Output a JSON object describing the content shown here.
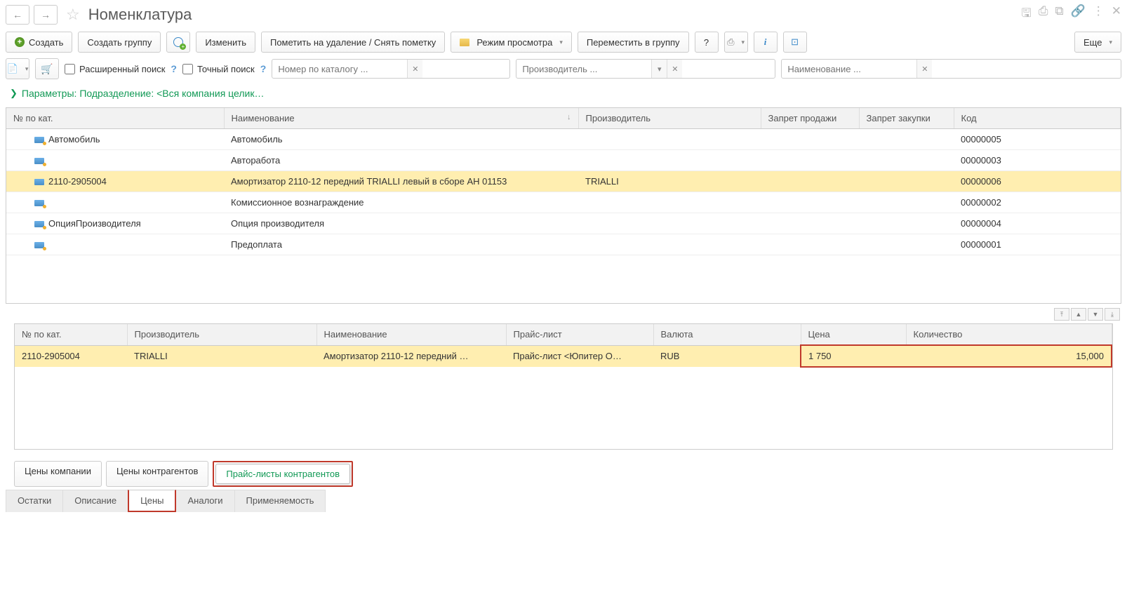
{
  "header": {
    "title": "Номенклатура"
  },
  "toolbar": {
    "create": "Создать",
    "create_group": "Создать группу",
    "edit": "Изменить",
    "mark_delete": "Пометить на удаление / Снять пометку",
    "view_mode": "Режим просмотра",
    "move_to_group": "Переместить в группу",
    "help": "?",
    "more": "Еще"
  },
  "search": {
    "extended_search": "Расширенный поиск",
    "exact_search": "Точный поиск",
    "catalog_placeholder": "Номер по каталогу ...",
    "maker_placeholder": "Производитель ...",
    "name_placeholder": "Наименование ..."
  },
  "params_line": "Параметры: Подразделение: <Вся компания целик…",
  "main_table": {
    "headers": {
      "cat_num": "№ по кат.",
      "name": "Наименование",
      "maker": "Производитель",
      "sale_block": "Запрет продажи",
      "buy_block": "Запрет закупки",
      "code": "Код"
    },
    "rows": [
      {
        "cat": "Автомобиль",
        "name": "Автомобиль",
        "maker": "",
        "code": "00000005",
        "selected": false,
        "dot": true
      },
      {
        "cat": "",
        "name": "Авторабота",
        "maker": "",
        "code": "00000003",
        "selected": false,
        "dot": true
      },
      {
        "cat": "2110-2905004",
        "name": "Амортизатор 2110-12 передний TRIALLI левый в сборе AH 01153",
        "maker": "TRIALLI",
        "code": "00000006",
        "selected": true,
        "dot": false
      },
      {
        "cat": "",
        "name": "Комиссионное вознаграждение",
        "maker": "",
        "code": "00000002",
        "selected": false,
        "dot": true
      },
      {
        "cat": "ОпцияПроизводителя",
        "name": "Опция производителя",
        "maker": "",
        "code": "00000004",
        "selected": false,
        "dot": true
      },
      {
        "cat": "",
        "name": "Предоплата",
        "maker": "",
        "code": "00000001",
        "selected": false,
        "dot": true
      }
    ]
  },
  "detail_table": {
    "headers": {
      "cat_num": "№ по кат.",
      "maker": "Производитель",
      "name": "Наименование",
      "pricelist": "Прайс-лист",
      "currency": "Валюта",
      "price": "Цена",
      "qty": "Количество"
    },
    "rows": [
      {
        "cat": "2110-2905004",
        "maker": "TRIALLI",
        "name": "Амортизатор 2110-12 передний …",
        "pricelist": "Прайс-лист <Юпитер О…",
        "currency": "RUB",
        "price": "1 750",
        "qty": "15,000"
      }
    ]
  },
  "subtabs": {
    "company_prices": "Цены компании",
    "counterparty_prices": "Цены контрагентов",
    "counterparty_pricelists": "Прайс-листы контрагентов"
  },
  "bottom_tabs": {
    "stock": "Остатки",
    "description": "Описание",
    "prices": "Цены",
    "analogs": "Аналоги",
    "applicability": "Применяемость"
  }
}
